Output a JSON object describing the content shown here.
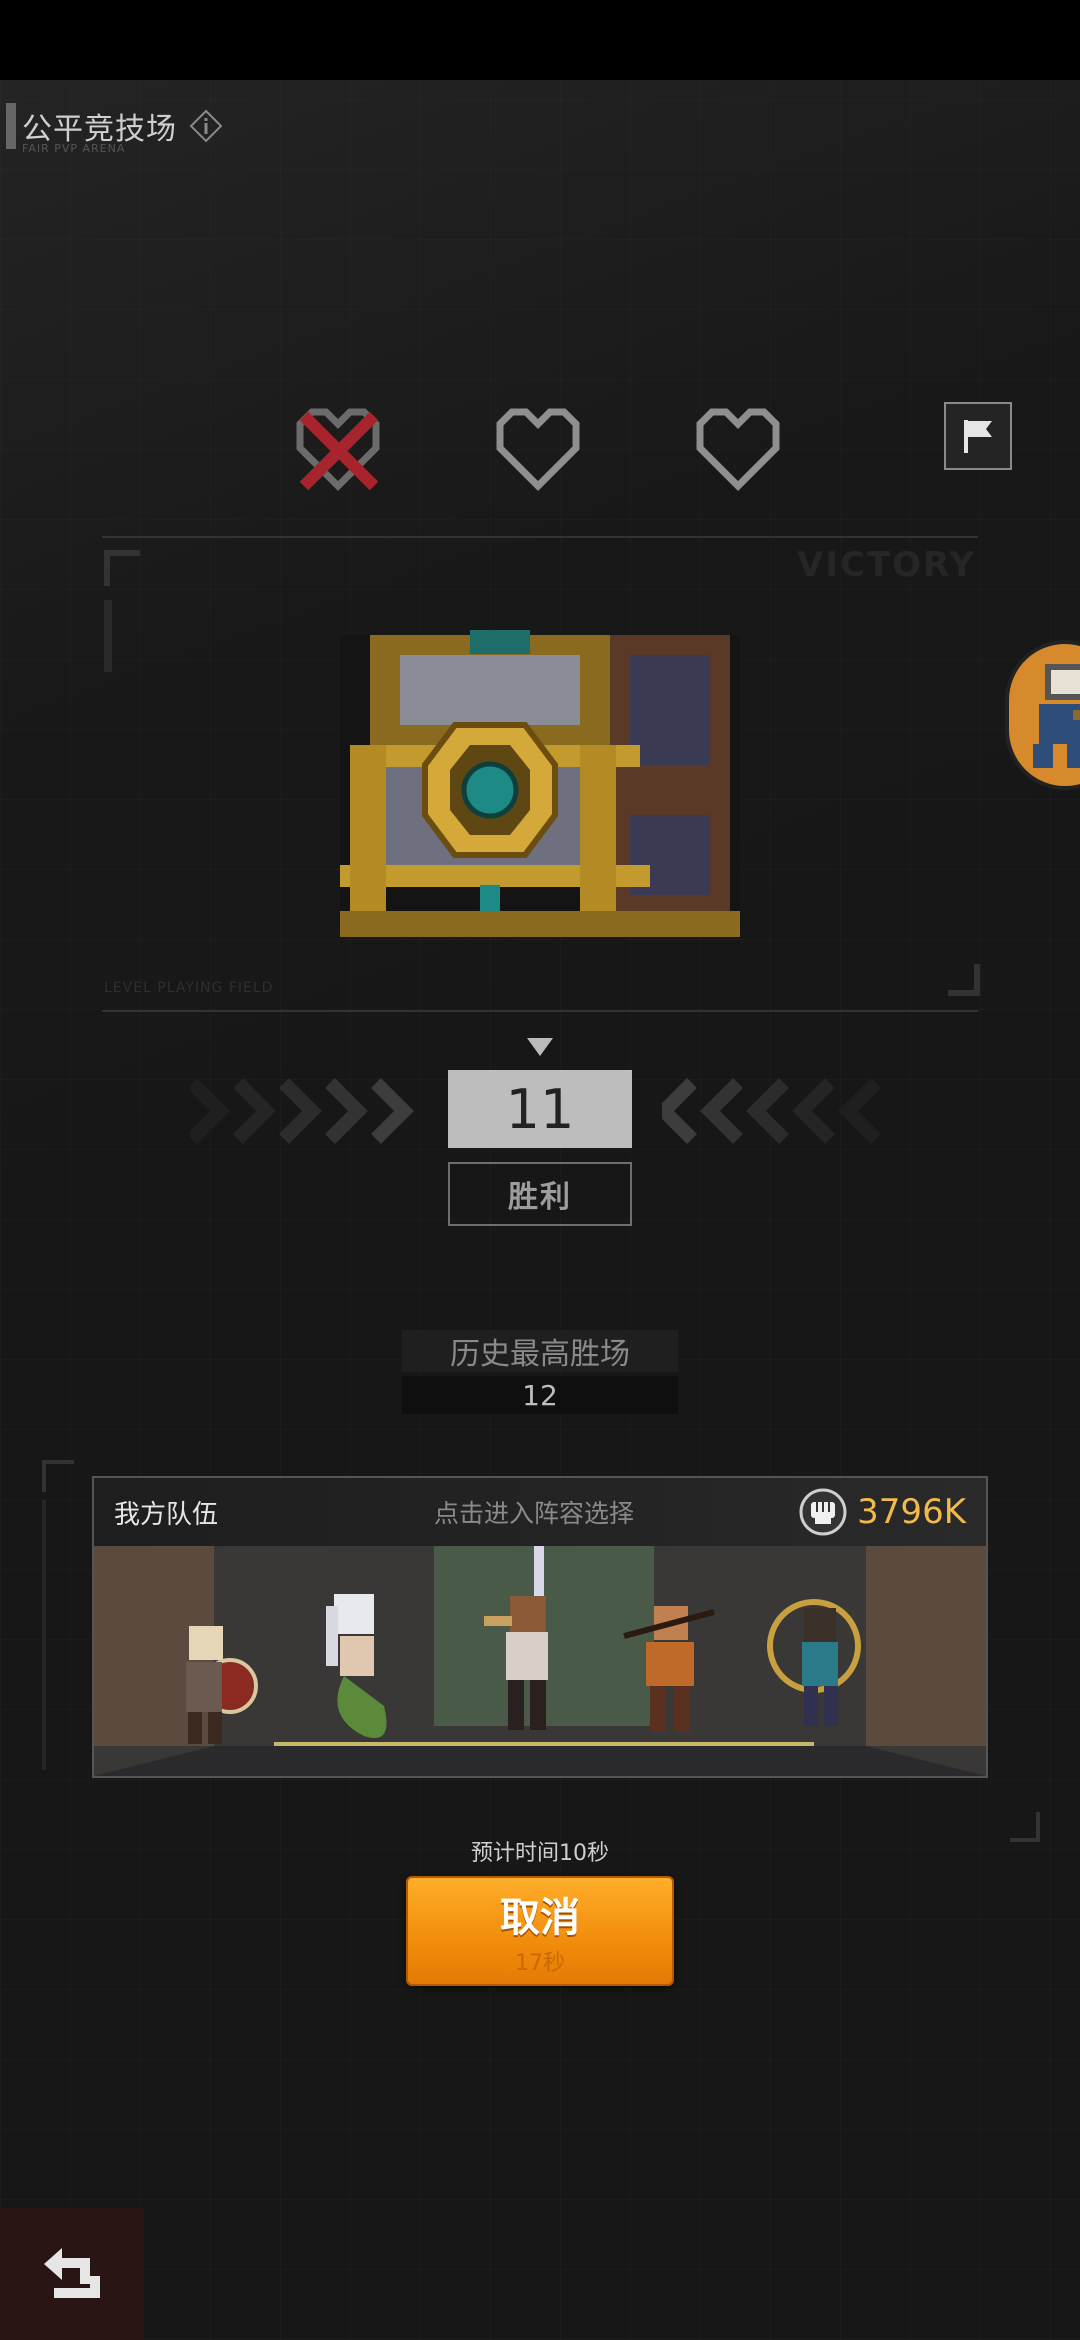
{
  "header": {
    "title": "公平竞技场",
    "subtitle": "FAIR PVP ARENA"
  },
  "lives": {
    "lost": 1,
    "total": 3
  },
  "result": {
    "victory_watermark": "VICTORY",
    "level_field": "LEVEL PLAYING FIELD",
    "wins": "11",
    "wins_label": "胜利"
  },
  "history": {
    "label": "历史最高胜场",
    "value": "12"
  },
  "team": {
    "title": "我方队伍",
    "hint": "点击进入阵容选择",
    "power": "3796K"
  },
  "matching": {
    "eta": "预计时间10秒",
    "cancel_label": "取消",
    "cancel_countdown": "17秒"
  },
  "colors": {
    "accent": "#f28c0b",
    "power": "#f2b94b",
    "lost_heart": "#a8242c"
  }
}
